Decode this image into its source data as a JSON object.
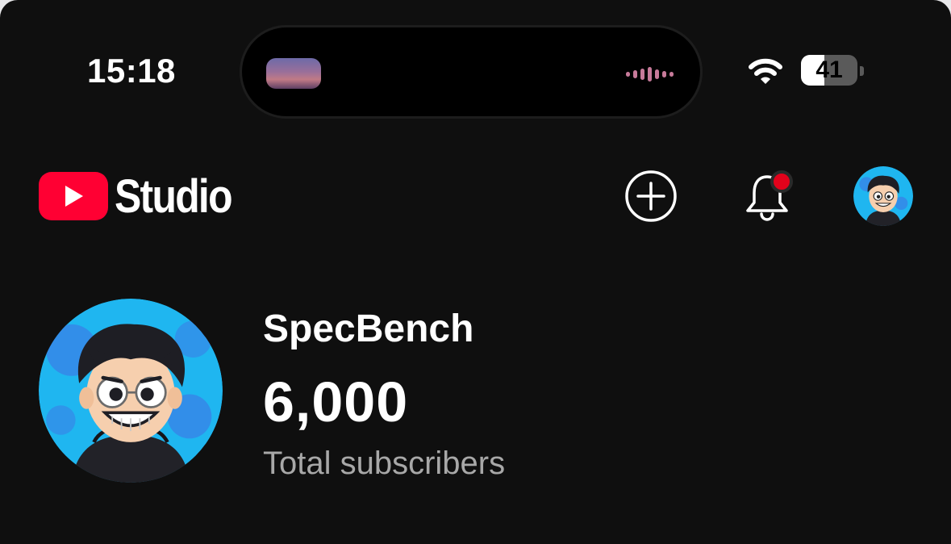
{
  "status_bar": {
    "time": "15:18",
    "battery_level": "41",
    "battery_fraction": 0.41
  },
  "header": {
    "brand_text": "Studio",
    "icons": {
      "logo": "youtube-logo-icon",
      "create": "add-circle-icon",
      "notifications": "bell-icon",
      "account": "channel-avatar-icon"
    },
    "has_unread_notifications": true
  },
  "channel": {
    "name": "SpecBench",
    "subscriber_count": "6,000",
    "subscriber_label": "Total subscribers"
  },
  "colors": {
    "background": "#0f0f0f",
    "brand_red": "#ff0033",
    "notification_dot": "#e3021b",
    "secondary_text": "#a8a8a8",
    "avatar_blue": "#1fb6f0"
  }
}
